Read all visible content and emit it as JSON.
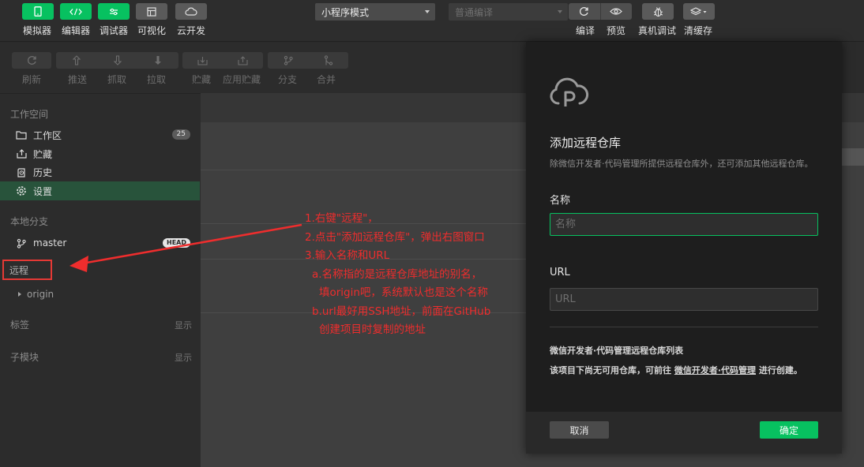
{
  "toolbar": {
    "left_buttons": [
      {
        "label": "模拟器",
        "icon": "phone-icon"
      },
      {
        "label": "编辑器",
        "icon": "code-icon"
      },
      {
        "label": "调试器",
        "icon": "debugger-icon"
      },
      {
        "label": "可视化",
        "icon": "layout-icon"
      },
      {
        "label": "云开发",
        "icon": "cloud-icon"
      }
    ],
    "mode_select": "小程序模式",
    "compile_select": "普通编译",
    "right_buttons": [
      {
        "label": "编译",
        "icon": "refresh-icon"
      },
      {
        "label": "预览",
        "icon": "eye-icon"
      },
      {
        "label": "真机调试",
        "icon": "bug-icon"
      },
      {
        "label": "清缓存",
        "icon": "layers-icon"
      }
    ]
  },
  "git_toolbar": {
    "buttons": [
      {
        "label": "刷新",
        "icon": "refresh-icon"
      },
      {
        "label": "推送",
        "icon": "push-icon"
      },
      {
        "label": "抓取",
        "icon": "fetch-icon"
      },
      {
        "label": "拉取",
        "icon": "pull-icon"
      },
      {
        "label": "贮藏",
        "icon": "stash-icon"
      },
      {
        "label": "应用贮藏",
        "icon": "apply-stash-icon"
      },
      {
        "label": "分支",
        "icon": "branch-icon"
      },
      {
        "label": "合并",
        "icon": "merge-icon"
      }
    ]
  },
  "sidebar": {
    "workspace_title": "工作空间",
    "workspace_items": [
      {
        "label": "工作区",
        "icon": "folder-icon",
        "badge": "25"
      },
      {
        "label": "贮藏",
        "icon": "stash-icon"
      },
      {
        "label": "历史",
        "icon": "history-icon"
      },
      {
        "label": "设置",
        "icon": "gear-icon"
      }
    ],
    "local_branch_title": "本地分支",
    "branch": {
      "label": "master",
      "badge": "HEAD"
    },
    "remote_title": "远程",
    "remote_item": "origin",
    "tags_title": "标签",
    "tags_action": "显示",
    "submodule_title": "子模块",
    "submodule_action": "显示"
  },
  "annotation": {
    "lines": [
      "1.右键\"远程\"，",
      "2.点击\"添加远程仓库\"，弹出右图窗口",
      "3.输入名称和URL",
      "  a.名称指的是远程仓库地址的别名，",
      "    填origin吧，系统默认也是这个名称",
      "  b.url最好用SSH地址，前面在GitHub",
      "    创建项目时复制的地址"
    ],
    "color": "#ef2d2d"
  },
  "dialog": {
    "title": "添加远程仓库",
    "description": "除微信开发者·代码管理所提供远程仓库外，还可添加其他远程仓库。",
    "name_label": "名称",
    "name_placeholder": "名称",
    "url_label": "URL",
    "url_placeholder": "URL",
    "list_title": "微信开发者·代码管理远程仓库列表",
    "empty_prefix": "该项目下尚无可用仓库，可前往 ",
    "empty_link": "微信开发者·代码管理",
    "empty_suffix": " 进行创建。",
    "cancel_label": "取消",
    "confirm_label": "确定"
  },
  "colors": {
    "accent": "#07c160",
    "annotation": "#ef2d2d",
    "active_item": "#28533b"
  }
}
